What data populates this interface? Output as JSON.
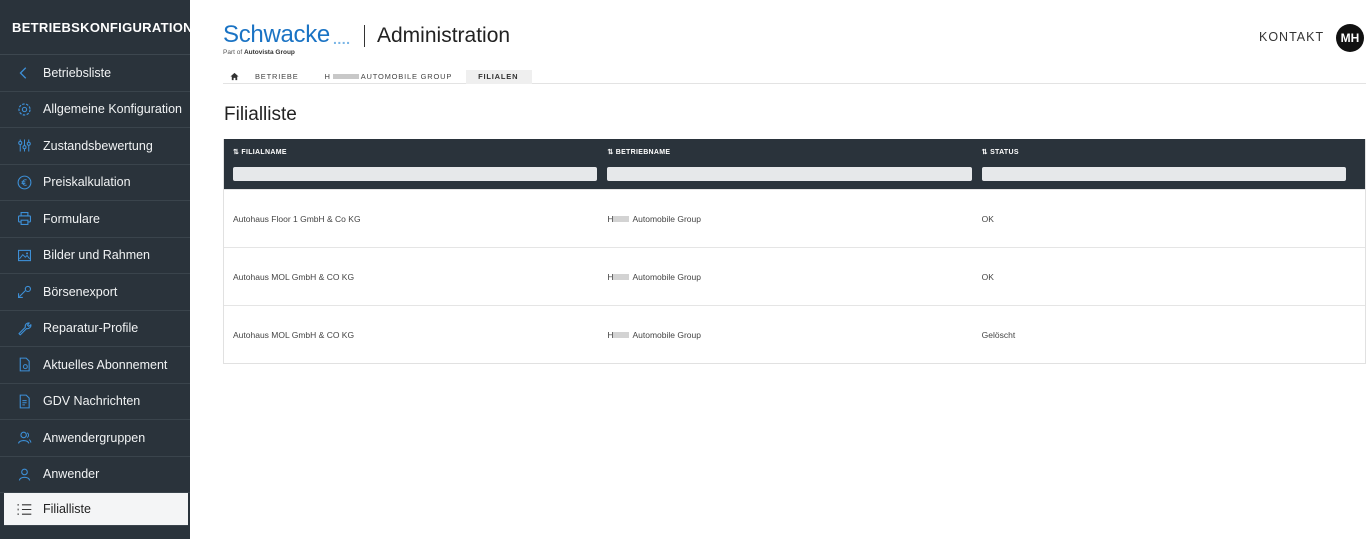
{
  "sidebar": {
    "title": "BETRIEBSKONFIGURATION",
    "back_label": "Betriebsliste",
    "items": [
      {
        "label": "Allgemeine Konfiguration",
        "icon": "gear-icon"
      },
      {
        "label": "Zustandsbewertung",
        "icon": "sliders-icon"
      },
      {
        "label": "Preiskalkulation",
        "icon": "euro-icon"
      },
      {
        "label": "Formulare",
        "icon": "printer-icon"
      },
      {
        "label": "Bilder und Rahmen",
        "icon": "image-icon"
      },
      {
        "label": "Börsenexport",
        "icon": "export-icon"
      },
      {
        "label": "Reparatur-Profile",
        "icon": "wrench-icon"
      },
      {
        "label": "Aktuelles Abonnement",
        "icon": "document-icon"
      },
      {
        "label": "GDV Nachrichten",
        "icon": "message-document-icon"
      },
      {
        "label": "Anwendergruppen",
        "icon": "user-group-icon"
      },
      {
        "label": "Anwender",
        "icon": "user-icon"
      }
    ],
    "active_item": {
      "label": "Filialliste",
      "icon": "list-icon"
    }
  },
  "header": {
    "logo_text": "Schwacke",
    "logo_dots": "....",
    "logo_sub_prefix": "Part of",
    "logo_sub_brand": "Autovista Group",
    "title": "Administration",
    "contact_label": "KONTAKT",
    "avatar_initials": "MH"
  },
  "breadcrumb": {
    "home_icon": "home-icon",
    "seg1": "BETRIEBE",
    "seg2_prefix": "H",
    "seg2_suffix": "AUTOMOBILE GROUP",
    "seg3": "FILIALEN"
  },
  "page": {
    "title": "Filialliste"
  },
  "table": {
    "columns": [
      "⇅ FILIALNAME",
      "⇅ BETRIEBNAME",
      "⇅ STATUS"
    ],
    "rows": [
      {
        "filialname": "Autohaus Floor 1 GmbH & Co KG",
        "betrieb_prefix": "H",
        "betrieb_suffix": "Automobile Group",
        "status": "OK"
      },
      {
        "filialname": "Autohaus MOL GmbH & CO KG",
        "betrieb_prefix": "H",
        "betrieb_suffix": "Automobile Group",
        "status": "OK"
      },
      {
        "filialname": "Autohaus MOL GmbH & CO KG",
        "betrieb_prefix": "H",
        "betrieb_suffix": "Automobile Group",
        "status": "Gelöscht"
      }
    ]
  },
  "colors": {
    "sidebar_bg": "#2a333b",
    "icon_blue": "#3d8fd6",
    "brand_blue": "#1a73c4"
  }
}
